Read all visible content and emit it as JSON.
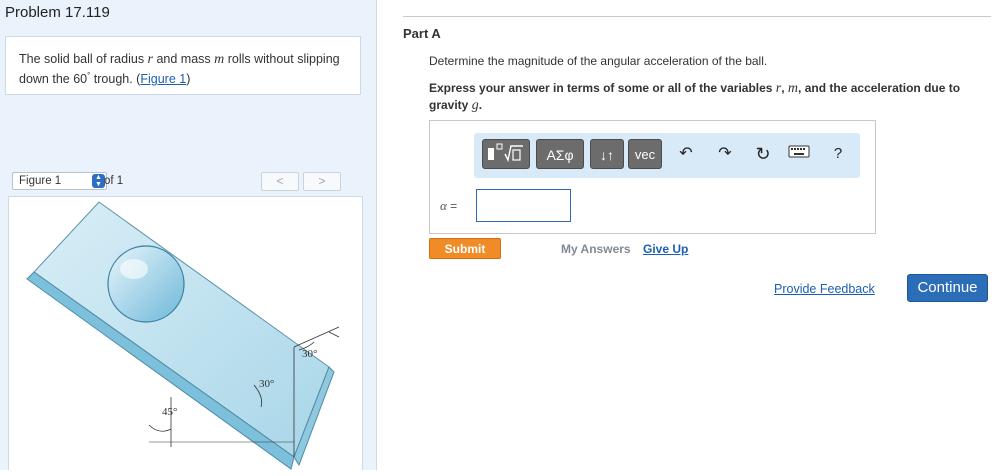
{
  "problem": {
    "title": "Problem 17.119",
    "text_1": "The solid ball of radius ",
    "var_r": "r",
    "text_2": " and mass ",
    "var_m": "m",
    "text_3": " rolls without slipping down the 60",
    "degree_mark": "°",
    "text_4": " trough. (",
    "figure_link": "Figure 1",
    "text_5": ")"
  },
  "figure_nav": {
    "selected": "Figure 1",
    "of_text": "of 1",
    "prev": "<",
    "next": ">"
  },
  "figure": {
    "angle_top": "30°",
    "angle_mid": "30°",
    "angle_left": "45°"
  },
  "part": {
    "title": "Part A",
    "question": "Determine the magnitude of the angular acceleration of the ball.",
    "instr_1": "Express your answer in terms of some or all of the variables ",
    "var_r": "r",
    "comma": ", ",
    "var_m": "m",
    "instr_2": ", and the acceleration due to gravity ",
    "var_g": "g",
    "period": "."
  },
  "toolbar": {
    "greek": "ΑΣφ",
    "arrows": "↓↑",
    "vec": "vec",
    "undo": "↶",
    "redo": "↷",
    "reset": "↻",
    "help": "?"
  },
  "answer": {
    "alpha": "α",
    "equals": " =",
    "value": ""
  },
  "actions": {
    "submit": "Submit",
    "my_answers": "My Answers",
    "give_up": "Give Up",
    "feedback": "Provide Feedback",
    "continue": "Continue"
  },
  "colors": {
    "accent": "#2b6db6",
    "submit": "#f08c28",
    "panel": "#eaf3fb"
  }
}
